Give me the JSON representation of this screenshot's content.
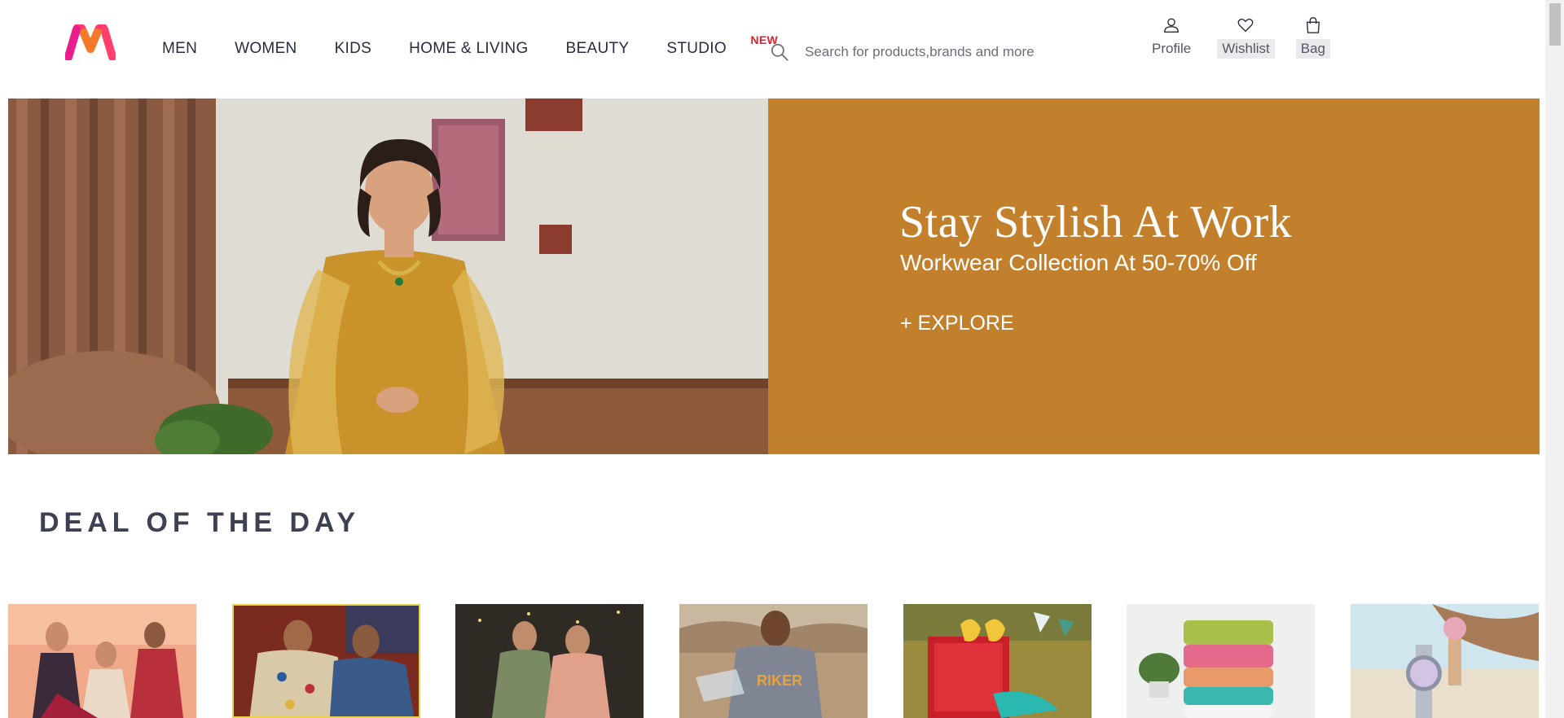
{
  "header": {
    "logo": "myntra-logo",
    "nav": [
      {
        "label": "MEN"
      },
      {
        "label": "WOMEN"
      },
      {
        "label": "KIDS"
      },
      {
        "label": "HOME & LIVING"
      },
      {
        "label": "BEAUTY"
      },
      {
        "label": "STUDIO",
        "badge": "NEW"
      }
    ],
    "search": {
      "placeholder": "Search for products,brands and more",
      "icon": "search-icon"
    },
    "actions": [
      {
        "label": "Profile",
        "icon": "user-icon"
      },
      {
        "label": "Wishlist",
        "icon": "heart-icon"
      },
      {
        "label": "Bag",
        "icon": "bag-icon"
      }
    ]
  },
  "banner": {
    "title": "Stay Stylish At Work",
    "subtitle": "Workwear Collection At 50-70% Off",
    "cta": "+ EXPLORE",
    "panel_color": "#c3802c"
  },
  "deals": {
    "title": "DEAL OF THE DAY",
    "cards": [
      {
        "name": "deal-card-festive-family"
      },
      {
        "name": "deal-card-men-printed-shirts"
      },
      {
        "name": "deal-card-women-ethnic"
      },
      {
        "name": "deal-card-men-tshirt-outdoor"
      },
      {
        "name": "deal-card-women-footwear"
      },
      {
        "name": "deal-card-home-towels"
      },
      {
        "name": "deal-card-watches"
      }
    ]
  },
  "colors": {
    "accent": "#ff3f6c",
    "new_badge": "#e0202b",
    "text": "#282c3f"
  }
}
